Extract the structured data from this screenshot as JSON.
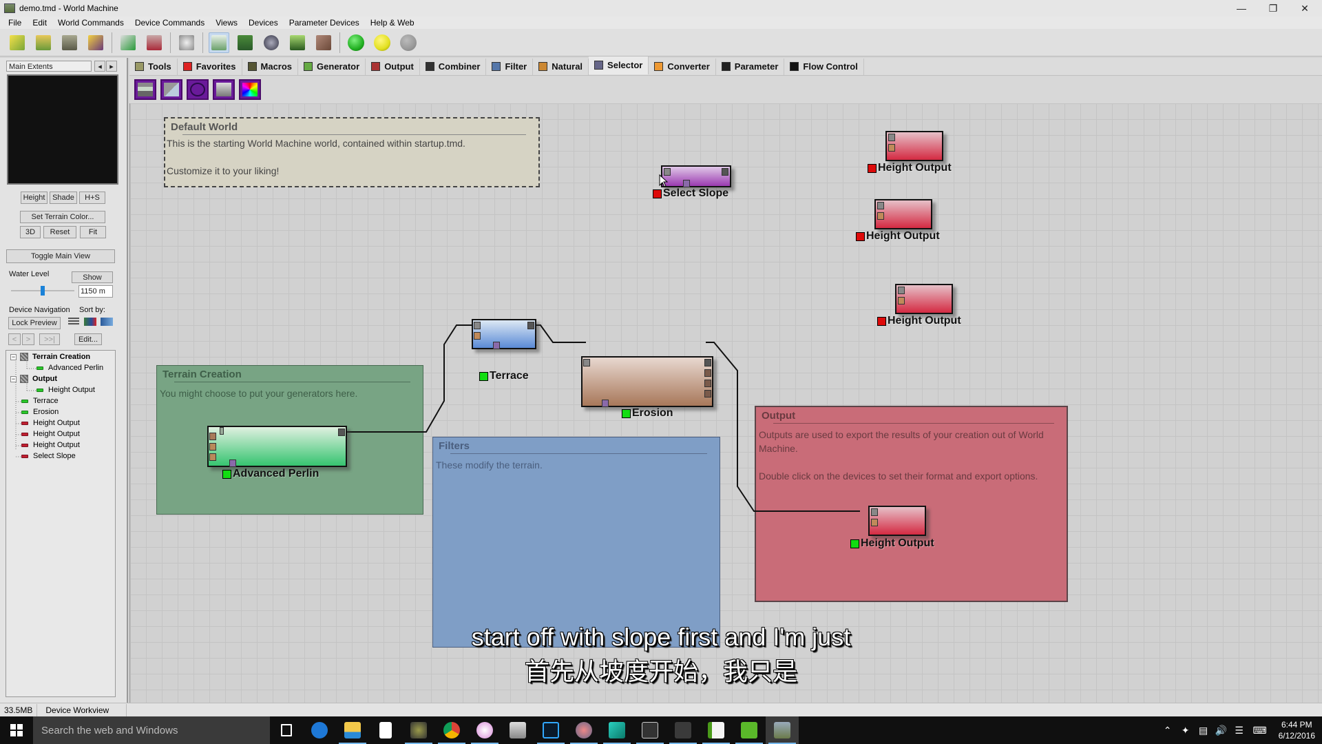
{
  "window": {
    "title": "demo.tmd - World Machine",
    "controls": [
      "minimize",
      "restore",
      "close"
    ]
  },
  "menu": [
    "File",
    "Edit",
    "World Commands",
    "Device Commands",
    "Views",
    "Devices",
    "Parameter Devices",
    "Help & Web"
  ],
  "toolbar": {
    "buttons": [
      "new-world",
      "open",
      "save",
      "save-as",
      "export",
      "render-options",
      "randomize",
      "device-view",
      "layout-view",
      "3d-view",
      "explorer-view",
      "terrain-view"
    ],
    "build_lights": [
      {
        "name": "build",
        "color": "#22b022"
      },
      {
        "name": "build-extents",
        "color": "#e2e020"
      },
      {
        "name": "stop",
        "color": "#9a9a9a"
      }
    ]
  },
  "left_panel": {
    "extents_select": "Main Extents",
    "view_buttons": [
      "Height",
      "Shade",
      "H+S"
    ],
    "set_terrain_color": "Set Terrain Color...",
    "view_controls": [
      "3D",
      "Reset",
      "Fit"
    ],
    "toggle_main_view": "Toggle Main View",
    "water_level_label": "Water Level",
    "water_show": "Show",
    "water_level_value": "1150 m",
    "water_slider_fraction": 0.5,
    "device_navigation_label": "Device Navigation",
    "sort_by_label": "Sort by:",
    "lock_preview": "Lock Preview",
    "nav_buttons": [
      "<",
      ">",
      ">>|"
    ],
    "edit_button": "Edit...",
    "tree": [
      {
        "label": "Terrain Creation",
        "type": "group",
        "level": 0
      },
      {
        "label": "Advanced Perlin",
        "type": "device",
        "status": "green",
        "level": 1
      },
      {
        "label": "Output",
        "type": "group",
        "level": 0
      },
      {
        "label": "Height Output",
        "type": "device",
        "status": "green",
        "level": 1
      },
      {
        "label": "Terrace",
        "type": "device",
        "status": "green",
        "level": 0
      },
      {
        "label": "Erosion",
        "type": "device",
        "status": "green",
        "level": 0
      },
      {
        "label": "Height Output",
        "type": "device",
        "status": "red",
        "level": 0
      },
      {
        "label": "Height Output",
        "type": "device",
        "status": "red",
        "level": 0
      },
      {
        "label": "Height Output",
        "type": "device",
        "status": "red",
        "level": 0
      },
      {
        "label": "Select Slope",
        "type": "device",
        "status": "red",
        "level": 0
      }
    ]
  },
  "tabs": [
    {
      "label": "Tools",
      "icon": "tools-icon"
    },
    {
      "label": "Favorites",
      "icon": "heart-icon"
    },
    {
      "label": "Macros",
      "icon": "macro-icon"
    },
    {
      "label": "Generator",
      "icon": "generator-icon"
    },
    {
      "label": "Output",
      "icon": "output-icon"
    },
    {
      "label": "Combiner",
      "icon": "combiner-icon"
    },
    {
      "label": "Filter",
      "icon": "filter-icon"
    },
    {
      "label": "Natural",
      "icon": "natural-icon"
    },
    {
      "label": "Selector",
      "icon": "selector-icon",
      "selected": true
    },
    {
      "label": "Converter",
      "icon": "converter-icon"
    },
    {
      "label": "Parameter",
      "icon": "parameter-icon"
    },
    {
      "label": "Flow Control",
      "icon": "flow-control-icon"
    }
  ],
  "selector_devices": [
    "select-height",
    "select-slope",
    "select-convexity",
    "select-curvature",
    "select-color"
  ],
  "groups": [
    {
      "id": "default-world",
      "title": "Default World",
      "text": "This is the starting World Machine world, contained within startup.tmd.\n\nCustomize it to your liking!"
    },
    {
      "id": "terrain-creation",
      "title": "Terrain Creation",
      "text": "You might choose to put your generators here."
    },
    {
      "id": "filters",
      "title": "Filters",
      "text": "These modify the terrain."
    },
    {
      "id": "output",
      "title": "Output",
      "text": "Outputs are used to export the results of your creation out of World Machine.\n\nDouble click on the devices to set their format and export options."
    }
  ],
  "nodes": [
    {
      "id": "select-slope",
      "label": "Select Slope",
      "status": "red"
    },
    {
      "id": "height-output-1",
      "label": "Height Output",
      "status": "red"
    },
    {
      "id": "height-output-2",
      "label": "Height Output",
      "status": "red"
    },
    {
      "id": "height-output-3",
      "label": "Height Output",
      "status": "red"
    },
    {
      "id": "terrace",
      "label": "Terrace",
      "status": "green"
    },
    {
      "id": "erosion",
      "label": "Erosion",
      "status": "green"
    },
    {
      "id": "advanced-perlin",
      "label": "Advanced Perlin",
      "status": "green"
    },
    {
      "id": "height-output-4",
      "label": "Height Output",
      "status": "green"
    }
  ],
  "status_colors": {
    "green": "#11dd11",
    "red": "#dd0a0a"
  },
  "subtitles": {
    "en": "start off with slope first and I'm just",
    "zh": "首先从坡度开始，我只是"
  },
  "statusbar": {
    "memory": "33.5MB",
    "mode": "Device Workview"
  },
  "taskbar": {
    "search_placeholder": "Search the web and Windows",
    "apps": [
      "task-view",
      "edge",
      "file-explorer",
      "store",
      "app-camera",
      "chrome",
      "itunes",
      "monitor-app",
      "photoshop",
      "snipping-tool",
      "app-teal",
      "epic-games",
      "app-dark",
      "camtasia-white",
      "camtasia-green",
      "world-machine"
    ],
    "time": "6:44 PM",
    "date": "6/12/2016"
  }
}
